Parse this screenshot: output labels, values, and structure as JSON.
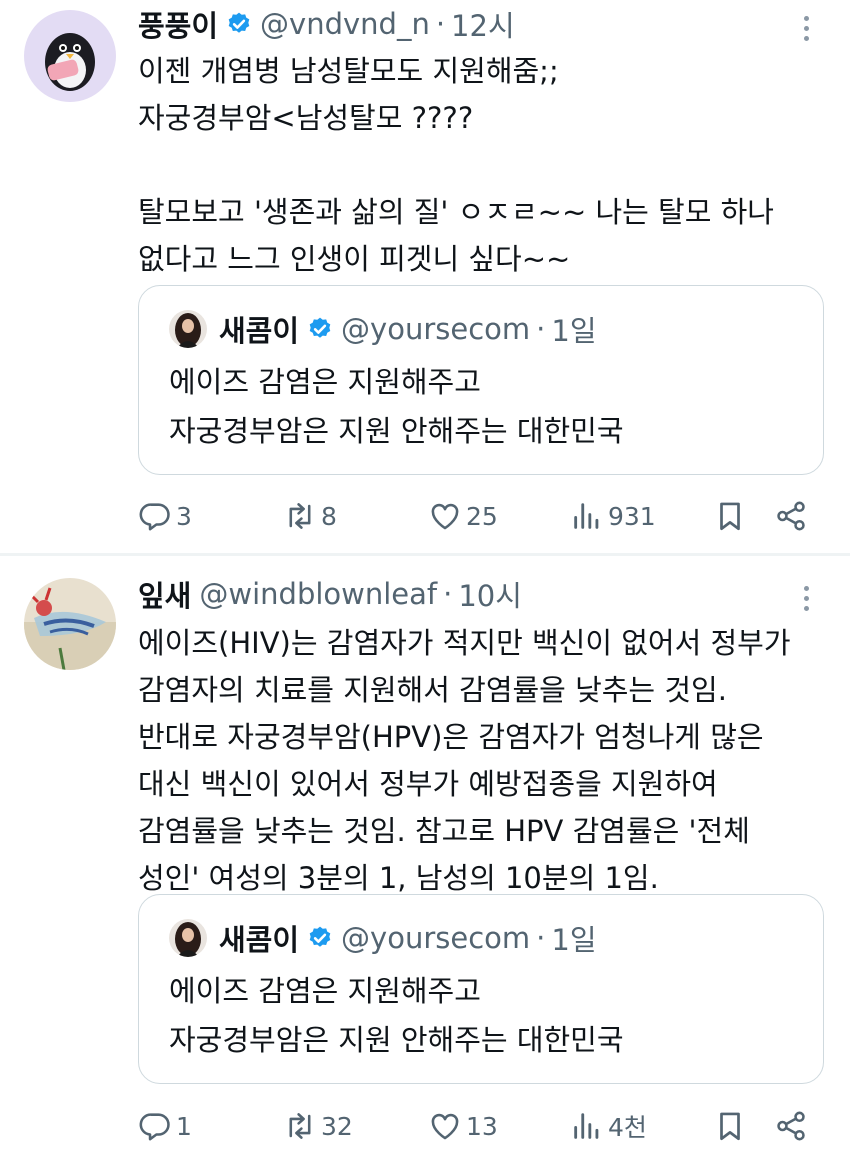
{
  "tweets": [
    {
      "author": {
        "name": "풍풍이",
        "handle": "@vndvnd_n",
        "time": "12시"
      },
      "body_lines": [
        "이젠 개염병 남성탈모도 지원해줌;;",
        "자궁경부암<남성탈모 ????",
        "",
        "탈모보고 '생존과 삶의 질' ㅇㅈㄹ~~ 나는 탈모 하나",
        "없다고 느그 인생이 피겟니 싶다~~"
      ],
      "quote": {
        "name": "새콤이",
        "handle": "@yoursecom",
        "time": "1일",
        "body_lines": [
          "에이즈 감염은 지원해주고",
          "자궁경부암은 지원 안해주는 대한민국"
        ]
      },
      "stats": {
        "replies": "3",
        "retweets": "8",
        "likes": "25",
        "views": "931"
      }
    },
    {
      "author": {
        "name": "잎새",
        "handle": "@windblownleaf",
        "time": "10시"
      },
      "body_lines": [
        "에이즈(HIV)는 감염자가 적지만 백신이 없어서 정부가",
        "감염자의 치료를 지원해서 감염률을 낮추는 것임.",
        "반대로 자궁경부암(HPV)은 감염자가 엄청나게 많은",
        "대신 백신이 있어서 정부가 예방접종을 지원하여",
        "감염률을 낮추는 것임. 참고로 HPV 감염률은 '전체",
        "성인' 여성의 3분의 1, 남성의 10분의 1임."
      ],
      "quote": {
        "name": "새콤이",
        "handle": "@yoursecom",
        "time": "1일",
        "body_lines": [
          "에이즈 감염은 지원해주고",
          "자궁경부암은 지원 안해주는 대한민국"
        ]
      },
      "stats": {
        "replies": "1",
        "retweets": "32",
        "likes": "13",
        "views": "4천"
      }
    }
  ],
  "separator": "·",
  "icons": {
    "verified": "verified-badge-icon",
    "more": "more-vertical-icon",
    "reply": "reply-icon",
    "retweet": "retweet-icon",
    "like": "heart-icon",
    "views": "views-icon",
    "bookmark": "bookmark-icon",
    "share": "share-icon"
  },
  "colors": {
    "text": "#0f1419",
    "secondary": "#536471",
    "verified": "#1d9bf0",
    "border": "#cfd9de"
  }
}
